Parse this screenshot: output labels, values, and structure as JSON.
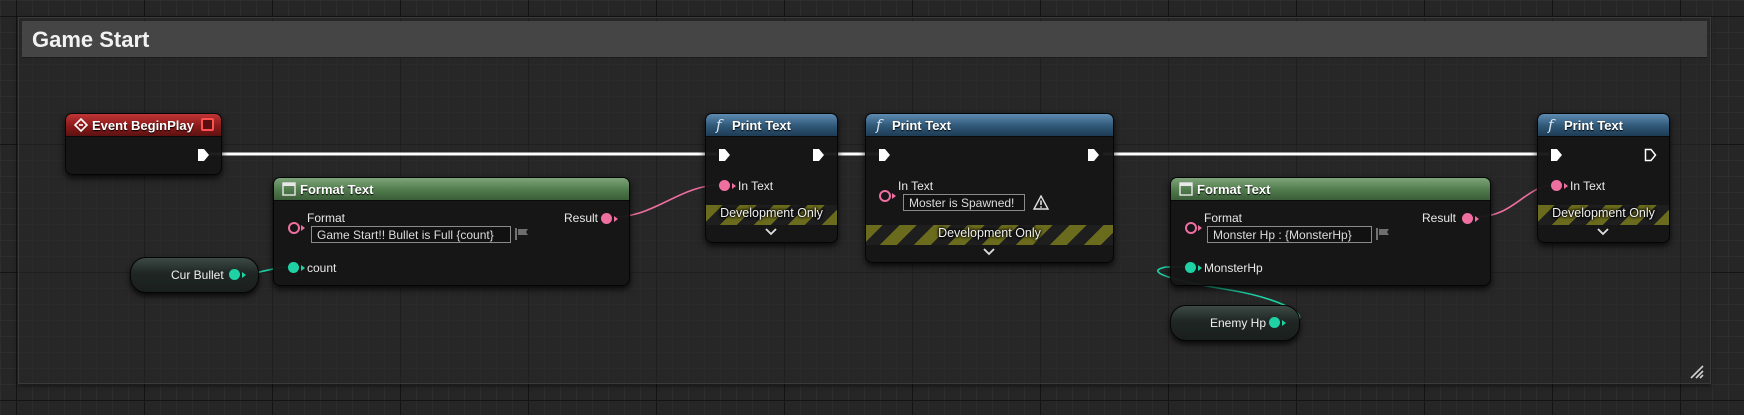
{
  "comment": {
    "title": "Game Start"
  },
  "nodes": {
    "event_begin_play": {
      "title": "Event BeginPlay"
    },
    "format_text_1": {
      "title": "Format Text",
      "format_label": "Format",
      "format_value": "Game Start!! Bullet is Full {count}",
      "result_label": "Result",
      "arg_label": "count"
    },
    "print_text_1": {
      "title": "Print Text",
      "in_text_label": "In Text",
      "dev_label": "Development Only"
    },
    "print_text_2": {
      "title": "Print Text",
      "in_text_label": "In Text",
      "in_text_value": "Moster is Spawned!",
      "dev_label": "Development Only"
    },
    "format_text_2": {
      "title": "Format Text",
      "format_label": "Format",
      "format_value": "Monster Hp : {MonsterHp}",
      "result_label": "Result",
      "arg_label": "MonsterHp"
    },
    "print_text_3": {
      "title": "Print Text",
      "in_text_label": "In Text",
      "dev_label": "Development Only"
    },
    "var_cur_bullet": {
      "label": "Cur Bullet"
    },
    "var_enemy_hp": {
      "label": "Enemy Hp"
    }
  },
  "colors": {
    "exec_wire": "#ffffff",
    "text_pin": "#ee6fa0",
    "int_pin": "#1ed2a6",
    "event_header": "#8a1a1a",
    "function_header": "#2f5776",
    "pure_header": "#4f7a4b"
  }
}
